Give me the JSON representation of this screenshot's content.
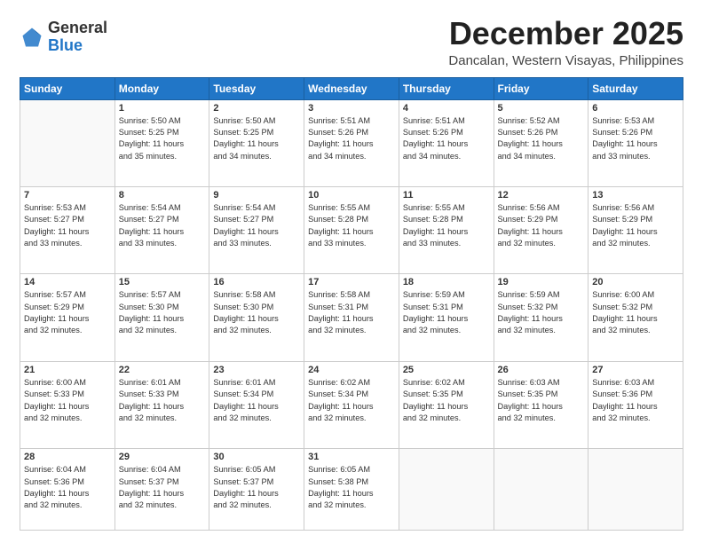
{
  "header": {
    "logo_general": "General",
    "logo_blue": "Blue",
    "month": "December 2025",
    "location": "Dancalan, Western Visayas, Philippines"
  },
  "weekdays": [
    "Sunday",
    "Monday",
    "Tuesday",
    "Wednesday",
    "Thursday",
    "Friday",
    "Saturday"
  ],
  "weeks": [
    [
      {
        "day": "",
        "info": ""
      },
      {
        "day": "1",
        "info": "Sunrise: 5:50 AM\nSunset: 5:25 PM\nDaylight: 11 hours\nand 35 minutes."
      },
      {
        "day": "2",
        "info": "Sunrise: 5:50 AM\nSunset: 5:25 PM\nDaylight: 11 hours\nand 34 minutes."
      },
      {
        "day": "3",
        "info": "Sunrise: 5:51 AM\nSunset: 5:26 PM\nDaylight: 11 hours\nand 34 minutes."
      },
      {
        "day": "4",
        "info": "Sunrise: 5:51 AM\nSunset: 5:26 PM\nDaylight: 11 hours\nand 34 minutes."
      },
      {
        "day": "5",
        "info": "Sunrise: 5:52 AM\nSunset: 5:26 PM\nDaylight: 11 hours\nand 34 minutes."
      },
      {
        "day": "6",
        "info": "Sunrise: 5:53 AM\nSunset: 5:26 PM\nDaylight: 11 hours\nand 33 minutes."
      }
    ],
    [
      {
        "day": "7",
        "info": "Sunrise: 5:53 AM\nSunset: 5:27 PM\nDaylight: 11 hours\nand 33 minutes."
      },
      {
        "day": "8",
        "info": "Sunrise: 5:54 AM\nSunset: 5:27 PM\nDaylight: 11 hours\nand 33 minutes."
      },
      {
        "day": "9",
        "info": "Sunrise: 5:54 AM\nSunset: 5:27 PM\nDaylight: 11 hours\nand 33 minutes."
      },
      {
        "day": "10",
        "info": "Sunrise: 5:55 AM\nSunset: 5:28 PM\nDaylight: 11 hours\nand 33 minutes."
      },
      {
        "day": "11",
        "info": "Sunrise: 5:55 AM\nSunset: 5:28 PM\nDaylight: 11 hours\nand 33 minutes."
      },
      {
        "day": "12",
        "info": "Sunrise: 5:56 AM\nSunset: 5:29 PM\nDaylight: 11 hours\nand 32 minutes."
      },
      {
        "day": "13",
        "info": "Sunrise: 5:56 AM\nSunset: 5:29 PM\nDaylight: 11 hours\nand 32 minutes."
      }
    ],
    [
      {
        "day": "14",
        "info": "Sunrise: 5:57 AM\nSunset: 5:29 PM\nDaylight: 11 hours\nand 32 minutes."
      },
      {
        "day": "15",
        "info": "Sunrise: 5:57 AM\nSunset: 5:30 PM\nDaylight: 11 hours\nand 32 minutes."
      },
      {
        "day": "16",
        "info": "Sunrise: 5:58 AM\nSunset: 5:30 PM\nDaylight: 11 hours\nand 32 minutes."
      },
      {
        "day": "17",
        "info": "Sunrise: 5:58 AM\nSunset: 5:31 PM\nDaylight: 11 hours\nand 32 minutes."
      },
      {
        "day": "18",
        "info": "Sunrise: 5:59 AM\nSunset: 5:31 PM\nDaylight: 11 hours\nand 32 minutes."
      },
      {
        "day": "19",
        "info": "Sunrise: 5:59 AM\nSunset: 5:32 PM\nDaylight: 11 hours\nand 32 minutes."
      },
      {
        "day": "20",
        "info": "Sunrise: 6:00 AM\nSunset: 5:32 PM\nDaylight: 11 hours\nand 32 minutes."
      }
    ],
    [
      {
        "day": "21",
        "info": "Sunrise: 6:00 AM\nSunset: 5:33 PM\nDaylight: 11 hours\nand 32 minutes."
      },
      {
        "day": "22",
        "info": "Sunrise: 6:01 AM\nSunset: 5:33 PM\nDaylight: 11 hours\nand 32 minutes."
      },
      {
        "day": "23",
        "info": "Sunrise: 6:01 AM\nSunset: 5:34 PM\nDaylight: 11 hours\nand 32 minutes."
      },
      {
        "day": "24",
        "info": "Sunrise: 6:02 AM\nSunset: 5:34 PM\nDaylight: 11 hours\nand 32 minutes."
      },
      {
        "day": "25",
        "info": "Sunrise: 6:02 AM\nSunset: 5:35 PM\nDaylight: 11 hours\nand 32 minutes."
      },
      {
        "day": "26",
        "info": "Sunrise: 6:03 AM\nSunset: 5:35 PM\nDaylight: 11 hours\nand 32 minutes."
      },
      {
        "day": "27",
        "info": "Sunrise: 6:03 AM\nSunset: 5:36 PM\nDaylight: 11 hours\nand 32 minutes."
      }
    ],
    [
      {
        "day": "28",
        "info": "Sunrise: 6:04 AM\nSunset: 5:36 PM\nDaylight: 11 hours\nand 32 minutes."
      },
      {
        "day": "29",
        "info": "Sunrise: 6:04 AM\nSunset: 5:37 PM\nDaylight: 11 hours\nand 32 minutes."
      },
      {
        "day": "30",
        "info": "Sunrise: 6:05 AM\nSunset: 5:37 PM\nDaylight: 11 hours\nand 32 minutes."
      },
      {
        "day": "31",
        "info": "Sunrise: 6:05 AM\nSunset: 5:38 PM\nDaylight: 11 hours\nand 32 minutes."
      },
      {
        "day": "",
        "info": ""
      },
      {
        "day": "",
        "info": ""
      },
      {
        "day": "",
        "info": ""
      }
    ]
  ]
}
